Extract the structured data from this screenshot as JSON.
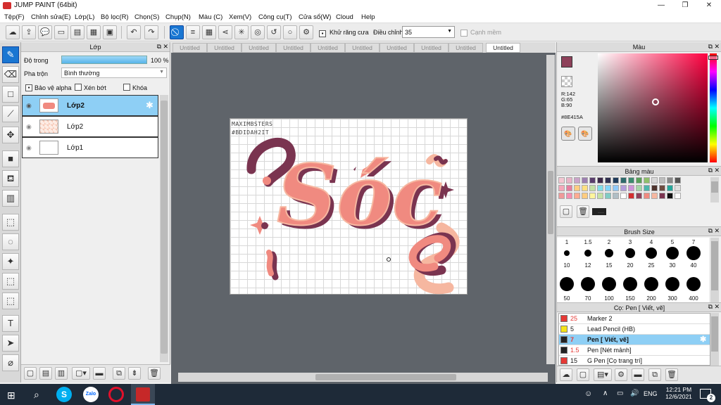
{
  "window": {
    "title": "JUMP PAINT (64bit)",
    "minimize": "—",
    "restore": "❐",
    "close": "✕"
  },
  "menu": [
    "Tệp(F)",
    "Chỉnh sửa(E)",
    "Lớp(L)",
    "Bộ lọc(R)",
    "Chọn(S)",
    "Chụp(N)",
    "Màu (C)",
    "Xem(V)",
    "Công cụ(T)",
    "Cửa sổ(W)",
    "Cloud",
    "Help"
  ],
  "toolbar": {
    "antialias_label": "Khử răng cưa",
    "adjust_label": "Điều chỉnh",
    "adjust_value": "35",
    "smooth_label": "Cạnh mềm"
  },
  "layer_panel": {
    "title": "Lớp",
    "opacity_label": "Độ trong",
    "opacity_value": "100 %",
    "opacity_fraction": 1.0,
    "blend_label": "Pha trộn",
    "blend_value": "Bình thường",
    "protect_alpha": "Bảo vệ alpha",
    "clip": "Xén bớt",
    "lock": "Khóa",
    "layers": [
      {
        "name": "Lớp2",
        "selected": true
      },
      {
        "name": "Lớp2",
        "selected": false
      },
      {
        "name": "Lớp1",
        "selected": false
      }
    ]
  },
  "tabs": [
    "Untitled",
    "Untitled",
    "Untitled",
    "Untitled",
    "Untitled",
    "Untitled",
    "Untitled",
    "Untitled",
    "Untitled",
    "Untitled"
  ],
  "canvas_text": {
    "line1": "MAXIMBSTERS",
    "line2": "#BDIDAH2IT",
    "main": "Sóc"
  },
  "color_panel": {
    "title": "Màu",
    "r": "R:142",
    "g": "G:65",
    "b": "B:90",
    "hex": "#8E415A"
  },
  "palette_panel": {
    "title": "Bảng màu",
    "dash": "---"
  },
  "brush_size_panel": {
    "title": "Brush Size",
    "sizes": [
      "1",
      "1.5",
      "2",
      "3",
      "4",
      "5",
      "7",
      "10",
      "12",
      "15",
      "20",
      "25",
      "30",
      "40",
      "50",
      "70",
      "100",
      "150",
      "200",
      "300",
      "400"
    ]
  },
  "brush_list_panel": {
    "title": "Cọ: Pen [ Viết, vẽ]",
    "items": [
      {
        "size": "25",
        "name": "Marker 2",
        "color": "#e53935"
      },
      {
        "size": "5",
        "name": "Lead Pencil (HB)",
        "color": "#f5e31a"
      },
      {
        "size": "7",
        "name": "Pen [ Viết, vẽ]",
        "color": "#222222",
        "selected": true
      },
      {
        "size": "1.5",
        "name": "Pen [Nét mảnh]",
        "color": "#222222"
      },
      {
        "size": "15",
        "name": "G Pen [Cọ trang trí]",
        "color": "#e53935"
      }
    ]
  },
  "taskbar": {
    "time": "12:21 PM",
    "date": "12/6/2021",
    "lang": "ENG",
    "notify_count": "2"
  },
  "colors": {
    "accent": "#1976d2",
    "current": "#8E415A",
    "coral": "#f08a80",
    "plum": "#7a3450",
    "peach": "#f6b7a0"
  }
}
